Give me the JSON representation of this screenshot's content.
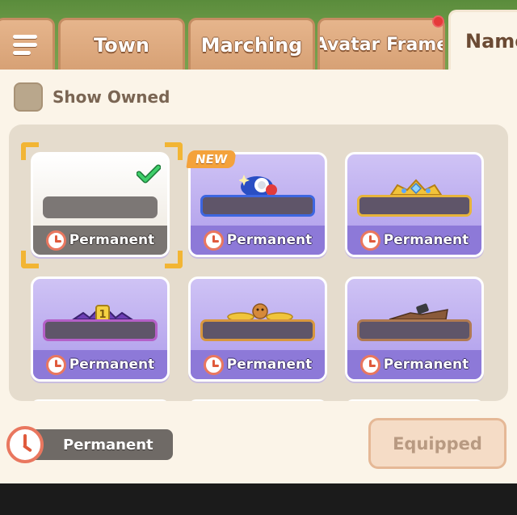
{
  "tabs": [
    {
      "label": "Town"
    },
    {
      "label": "Marching"
    },
    {
      "label": "Avatar Frame"
    },
    {
      "label": "Namep"
    }
  ],
  "filter": {
    "show_owned_label": "Show Owned",
    "checked": false
  },
  "grid": {
    "items": [
      {
        "status": "Permanent",
        "selected": true,
        "owned": true
      },
      {
        "status": "Permanent",
        "badge": "NEW"
      },
      {
        "status": "Permanent"
      },
      {
        "status": "Permanent"
      },
      {
        "status": "Permanent"
      },
      {
        "status": "Permanent"
      }
    ]
  },
  "footer": {
    "duration_label": "Permanent",
    "equip_label": "Equipped"
  },
  "colors": {
    "accent_gold": "#f2b534",
    "card_purple": "#ad9bea",
    "tab_brown": "#d7a175",
    "notification_red": "#e53a3a"
  }
}
